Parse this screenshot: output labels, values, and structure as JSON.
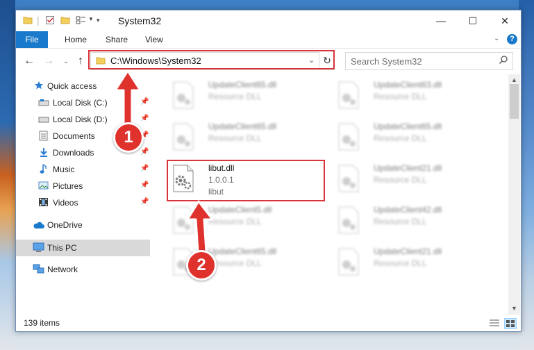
{
  "window": {
    "title": "System32",
    "controls": {
      "minimize": "—",
      "maximize": "☐",
      "close": "✕"
    }
  },
  "ribbon": {
    "tabs": [
      "File",
      "Home",
      "Share",
      "View"
    ],
    "help_icon": "?"
  },
  "address": {
    "path": "C:\\Windows\\System32",
    "search_placeholder": "Search System32"
  },
  "nav": {
    "items": [
      {
        "label": "Quick access",
        "icon": "star-icon",
        "pinned": false
      },
      {
        "label": "Local Disk (C:)",
        "icon": "drive-icon",
        "pinned": true
      },
      {
        "label": "Local Disk (D:)",
        "icon": "drive-icon",
        "pinned": true
      },
      {
        "label": "Documents",
        "icon": "documents-icon",
        "pinned": true
      },
      {
        "label": "Downloads",
        "icon": "downloads-icon",
        "pinned": true
      },
      {
        "label": "Music",
        "icon": "music-icon",
        "pinned": true
      },
      {
        "label": "Pictures",
        "icon": "pictures-icon",
        "pinned": true
      },
      {
        "label": "Videos",
        "icon": "videos-icon",
        "pinned": true
      },
      {
        "label": "OneDrive",
        "icon": "onedrive-icon",
        "pinned": false
      },
      {
        "label": "This PC",
        "icon": "pc-icon",
        "pinned": false,
        "selected": true
      },
      {
        "label": "Network",
        "icon": "network-icon",
        "pinned": false
      }
    ]
  },
  "files": {
    "left": [
      {
        "name": "UpdateClient65.dll",
        "type": "Resource DLL",
        "blurred": true
      },
      {
        "name": "UpdateClient65.dll",
        "type": "Resource DLL",
        "blurred": true
      },
      {
        "name": "libut.dll",
        "version": "1.0.0.1",
        "description": "libut",
        "blurred": false
      },
      {
        "name": "UpdateClient5.dll",
        "type": "Resource DLL",
        "blurred": true
      },
      {
        "name": "UpdateClient65.dll",
        "type": "Resource DLL",
        "blurred": true
      }
    ],
    "right": [
      {
        "name": "UpdateClient63.dll",
        "type": "Resource DLL",
        "blurred": true
      },
      {
        "name": "UpdateClient65.dll",
        "type": "Resource DLL",
        "blurred": true
      },
      {
        "name": "UpdateClient21.dll",
        "type": "Resource DLL",
        "blurred": true
      },
      {
        "name": "UpdateClient42.dll",
        "type": "Resource DLL",
        "blurred": true
      },
      {
        "name": "UpdateClient21.dll",
        "type": "Resource DLL",
        "blurred": true
      }
    ]
  },
  "status": {
    "item_count": "139 items"
  },
  "annotations": {
    "step1": "1",
    "step2": "2",
    "highlight_color": "#d9343a"
  }
}
